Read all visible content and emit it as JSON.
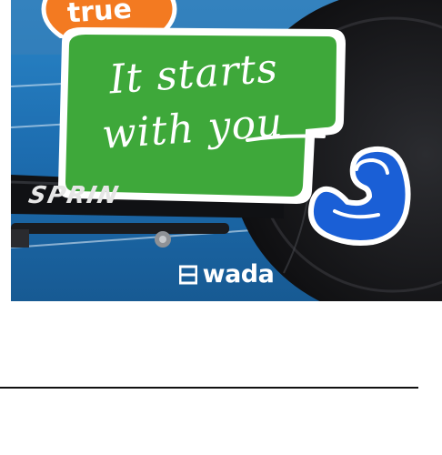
{
  "promo": {
    "badge_text": "true",
    "headline_line1": "It starts",
    "headline_line2": "with you",
    "bike_brand": "SPRIN",
    "logo_text": "wada",
    "colors": {
      "badge_orange": "#f37a21",
      "card_green": "#3ea83a",
      "track_blue": "#1f6fb0",
      "muscle_blue": "#1a5fd6",
      "wheel_dark": "#1b1b1d"
    },
    "icons": [
      "flexed-arm-icon",
      "wada-logo-icon"
    ]
  }
}
